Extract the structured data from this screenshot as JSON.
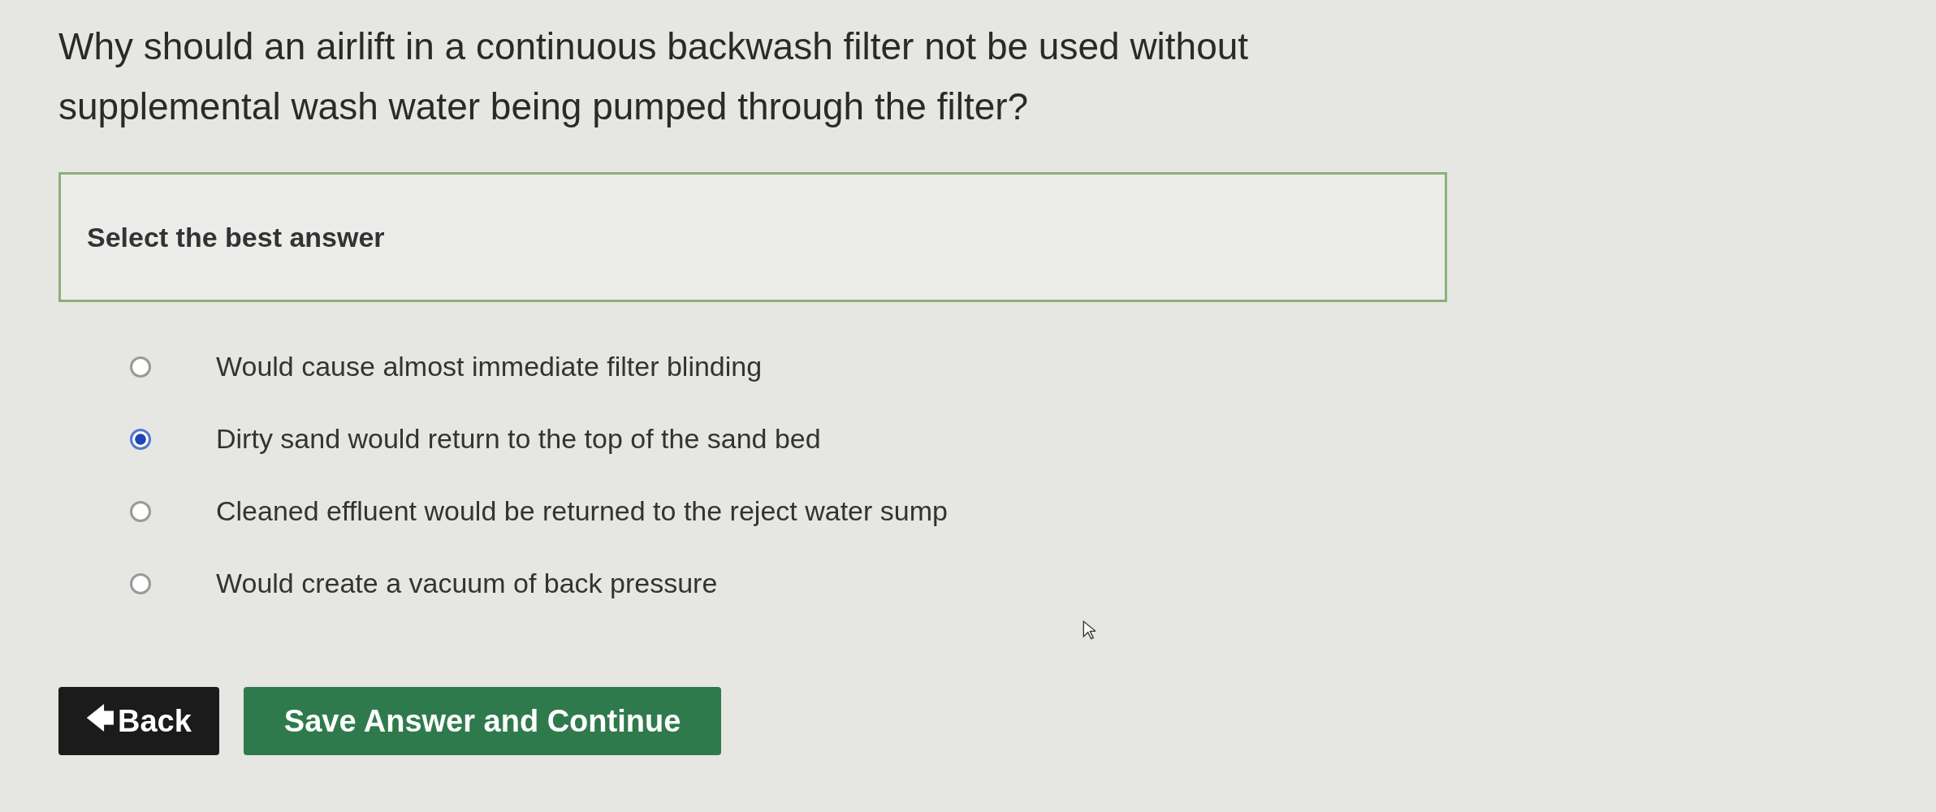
{
  "question": "Why should an airlift in a continuous backwash filter not be used without supplemental wash water being pumped through the filter?",
  "instruction": "Select the best answer",
  "options": [
    {
      "label": "Would cause almost immediate filter blinding",
      "selected": false
    },
    {
      "label": "Dirty sand would return to the top of the sand bed",
      "selected": true
    },
    {
      "label": "Cleaned effluent would be returned to the reject water sump",
      "selected": false
    },
    {
      "label": "Would create a vacuum of back pressure",
      "selected": false
    }
  ],
  "buttons": [
    {
      "kind": "back",
      "arrow": "🡄",
      "label": "Back"
    },
    {
      "kind": "save",
      "label": "Save Answer and Continue"
    }
  ]
}
